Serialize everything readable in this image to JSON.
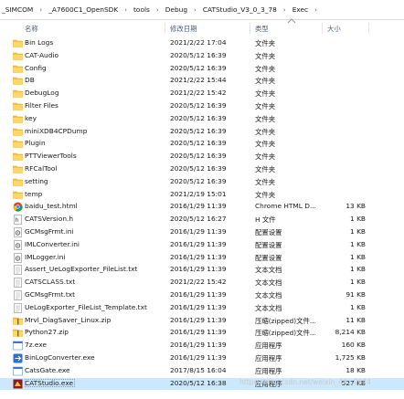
{
  "breadcrumb": [
    "_SIMCOM",
    "_A7600C1_OpenSDK",
    "tools",
    "Debug",
    "CATStudio_V3_0_3_78",
    "Exec"
  ],
  "columns": {
    "name": "名称",
    "date": "修改日期",
    "type": "类型",
    "size": "大小"
  },
  "files": [
    {
      "name": "Bin Logs",
      "date": "2021/2/22 17:04",
      "type": "文件夹",
      "size": "",
      "icon": "folder-icon"
    },
    {
      "name": "CAT-Audio",
      "date": "2020/5/12 16:39",
      "type": "文件夹",
      "size": "",
      "icon": "folder-icon"
    },
    {
      "name": "Config",
      "date": "2020/5/12 16:39",
      "type": "文件夹",
      "size": "",
      "icon": "folder-icon"
    },
    {
      "name": "DB",
      "date": "2021/2/22 15:44",
      "type": "文件夹",
      "size": "",
      "icon": "folder-icon"
    },
    {
      "name": "DebugLog",
      "date": "2021/2/22 15:42",
      "type": "文件夹",
      "size": "",
      "icon": "folder-icon"
    },
    {
      "name": "Filter Files",
      "date": "2020/5/12 16:39",
      "type": "文件夹",
      "size": "",
      "icon": "folder-icon"
    },
    {
      "name": "key",
      "date": "2020/5/12 16:39",
      "type": "文件夹",
      "size": "",
      "icon": "folder-icon"
    },
    {
      "name": "miniXDB4CPDump",
      "date": "2020/5/12 16:39",
      "type": "文件夹",
      "size": "",
      "icon": "folder-icon"
    },
    {
      "name": "Plugin",
      "date": "2020/5/12 16:39",
      "type": "文件夹",
      "size": "",
      "icon": "folder-icon"
    },
    {
      "name": "PTTViewerTools",
      "date": "2020/5/12 16:39",
      "type": "文件夹",
      "size": "",
      "icon": "folder-icon"
    },
    {
      "name": "RFCalTool",
      "date": "2020/5/12 16:39",
      "type": "文件夹",
      "size": "",
      "icon": "folder-icon"
    },
    {
      "name": "setting",
      "date": "2020/5/12 16:39",
      "type": "文件夹",
      "size": "",
      "icon": "folder-icon"
    },
    {
      "name": "temp",
      "date": "2021/2/19 15:01",
      "type": "文件夹",
      "size": "",
      "icon": "folder-icon"
    },
    {
      "name": "baidu_test.html",
      "date": "2016/1/29 11:39",
      "type": "Chrome HTML D...",
      "size": "13 KB",
      "icon": "chrome-icon"
    },
    {
      "name": "CATSVersion.h",
      "date": "2020/5/12 16:27",
      "type": "H 文件",
      "size": "1 KB",
      "icon": "header-file-icon"
    },
    {
      "name": "GCMsgFrmt.ini",
      "date": "2016/1/29 11:39",
      "type": "配置设置",
      "size": "1 KB",
      "icon": "settings-file-icon"
    },
    {
      "name": "IMLConverter.ini",
      "date": "2016/1/29 11:39",
      "type": "配置设置",
      "size": "1 KB",
      "icon": "settings-file-icon"
    },
    {
      "name": "IMLogger.ini",
      "date": "2016/1/29 11:39",
      "type": "配置设置",
      "size": "1 KB",
      "icon": "settings-file-icon"
    },
    {
      "name": "Assert_UeLogExporter_FileList.txt",
      "date": "2016/1/29 11:39",
      "type": "文本文档",
      "size": "1 KB",
      "icon": "text-file-icon"
    },
    {
      "name": "CATSCLASS.txt",
      "date": "2021/2/22 15:42",
      "type": "文本文档",
      "size": "1 KB",
      "icon": "text-file-icon"
    },
    {
      "name": "GCMsgFrmt.txt",
      "date": "2016/1/29 11:39",
      "type": "文本文档",
      "size": "91 KB",
      "icon": "text-file-icon"
    },
    {
      "name": "UeLogExporter_FileList_Template.txt",
      "date": "2016/1/29 11:39",
      "type": "文本文档",
      "size": "1 KB",
      "icon": "text-file-icon"
    },
    {
      "name": "Mrvl_DiagSaver_Linux.zip",
      "date": "2016/1/29 11:39",
      "type": "压缩(zipped)文件...",
      "size": "11 KB",
      "icon": "zip-folder-icon"
    },
    {
      "name": "Python27.zip",
      "date": "2016/1/29 11:39",
      "type": "压缩(zipped)文件...",
      "size": "8,214 KB",
      "icon": "zip-folder-icon"
    },
    {
      "name": "7z.exe",
      "date": "2016/1/29 11:39",
      "type": "应用程序",
      "size": "160 KB",
      "icon": "exe-icon"
    },
    {
      "name": "BinLogConverter.exe",
      "date": "2016/1/29 11:39",
      "type": "应用程序",
      "size": "1,725 KB",
      "icon": "binlog-exe-icon"
    },
    {
      "name": "CatsGate.exe",
      "date": "2017/8/15 16:04",
      "type": "应用程序",
      "size": "18 KB",
      "icon": "exe-icon"
    },
    {
      "name": "CATStudio.exe",
      "date": "2020/5/12 16:38",
      "type": "应用程序",
      "size": "527 KB",
      "icon": "catstudio-icon"
    }
  ],
  "selected_index": 27,
  "watermark": "https://blog.csdn.net/weixin_44...9674",
  "colors": {
    "selection": "#cce8ff",
    "folder": "#f3c64b",
    "header_text": "#4c607a"
  }
}
